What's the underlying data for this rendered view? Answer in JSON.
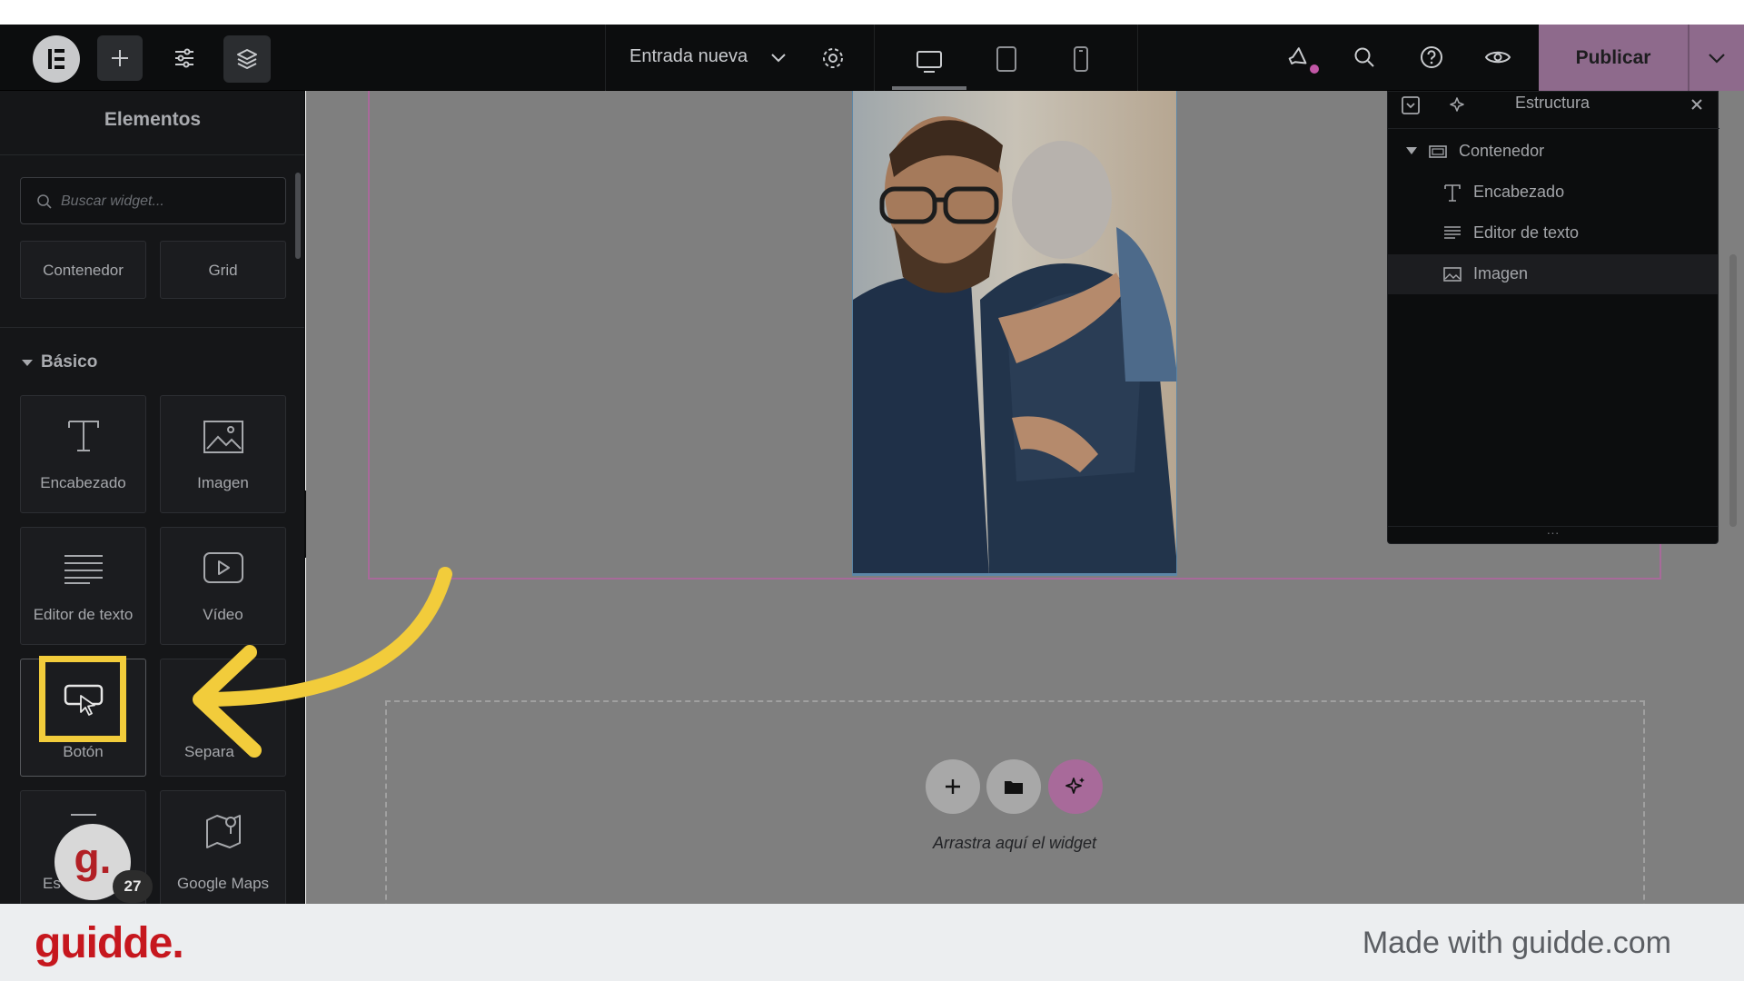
{
  "topbar": {
    "document_title": "Entrada nueva",
    "publish_label": "Publicar",
    "icons": [
      "elementor-logo-icon",
      "plus-icon",
      "sliders-icon",
      "layers-icon",
      "chevron-down-icon",
      "gear-icon",
      "desktop-icon",
      "tablet-icon",
      "mobile-icon",
      "megaphone-icon",
      "search-icon",
      "help-icon",
      "eye-icon"
    ],
    "accent_color": "#8e6a8c"
  },
  "left_panel": {
    "title": "Elementos",
    "search_placeholder": "Buscar widget...",
    "layout_widgets": [
      "Contenedor",
      "Grid"
    ],
    "category": "Básico",
    "basic_widgets": [
      {
        "label": "Encabezado",
        "icon": "heading-icon"
      },
      {
        "label": "Imagen",
        "icon": "image-icon"
      },
      {
        "label": "Editor de texto",
        "icon": "text-editor-icon"
      },
      {
        "label": "Vídeo",
        "icon": "video-icon"
      },
      {
        "label": "Botón",
        "icon": "button-icon"
      },
      {
        "label": "Separa",
        "icon": "divider-icon"
      },
      {
        "label": "Es",
        "icon": "spacer-icon"
      },
      {
        "label": "Google Maps",
        "icon": "map-icon"
      }
    ]
  },
  "canvas": {
    "dropzone_text": "Arrastra aquí el widget"
  },
  "structure_panel": {
    "title": "Estructura",
    "items": [
      {
        "label": "Contenedor"
      },
      {
        "label": "Encabezado"
      },
      {
        "label": "Editor de texto"
      },
      {
        "label": "Imagen"
      }
    ]
  },
  "guidde_badge": {
    "letter": "g.",
    "count": "27"
  },
  "footer": {
    "logo": "guidde.",
    "credit": "Made with guidde.com"
  },
  "colors": {
    "highlight": "#f2cc3b",
    "brand_red": "#c6171e"
  }
}
